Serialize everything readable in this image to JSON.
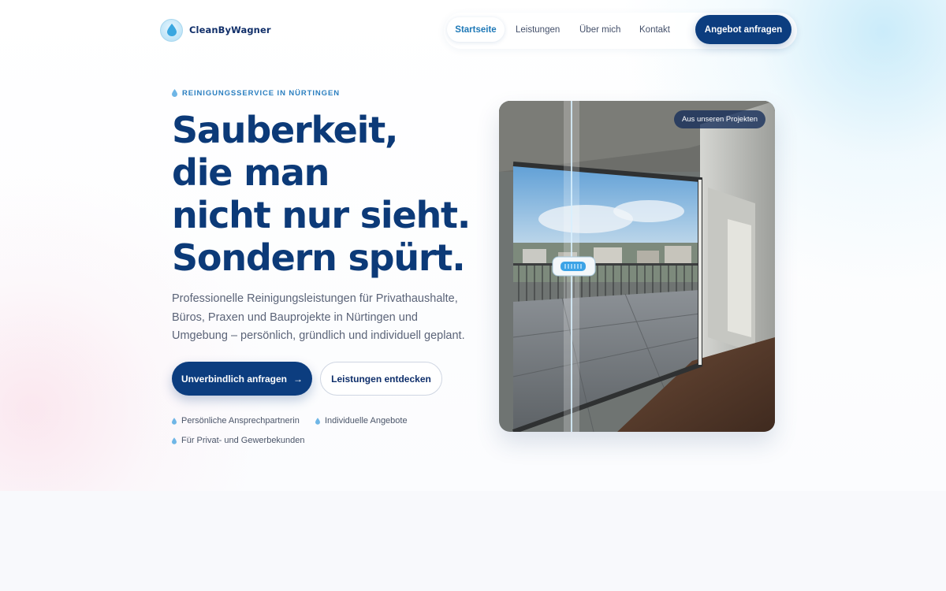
{
  "brand": {
    "name": "CleanByWagner",
    "logo_text": "CleanBy Wagner"
  },
  "nav": {
    "items": [
      {
        "label": "Startseite",
        "active": true
      },
      {
        "label": "Leistungen",
        "active": false
      },
      {
        "label": "Über mich",
        "active": false
      },
      {
        "label": "Kontakt",
        "active": false
      }
    ],
    "cta_label": "Angebot anfragen"
  },
  "hero": {
    "eyebrow": "REINIGUNGSSERVICE IN NÜRTINGEN",
    "headline_lines": [
      "Sauberkeit,",
      "die man",
      "nicht nur sieht."
    ],
    "headline_last_prefix": "Sondern ",
    "headline_highlight": "spürt",
    "headline_last_suffix": ".",
    "lead": "Professionelle Reinigungsleistungen für Privathaushalte, Büros, Praxen und Bauprojekte in Nürtingen und Umgebung – persönlich, gründlich und individuell geplant.",
    "primary_cta": "Unverbindlich anfragen",
    "primary_cta_arrow": "→",
    "secondary_cta": "Leistungen entdecken",
    "features": [
      "Persönliche Ansprechpartnerin",
      "Individuelle Angebote",
      "Für Privat- und Gewerbekunden"
    ]
  },
  "image": {
    "badge": "Aus unseren Projekten"
  },
  "colors": {
    "primary": "#0c3d7f",
    "accent": "#2b7fc0",
    "highlight": "#f4a6c4",
    "drop": "#6fb6e6"
  },
  "icons": {
    "drop": "water-drop-icon",
    "arrow": "arrow-right-icon"
  }
}
